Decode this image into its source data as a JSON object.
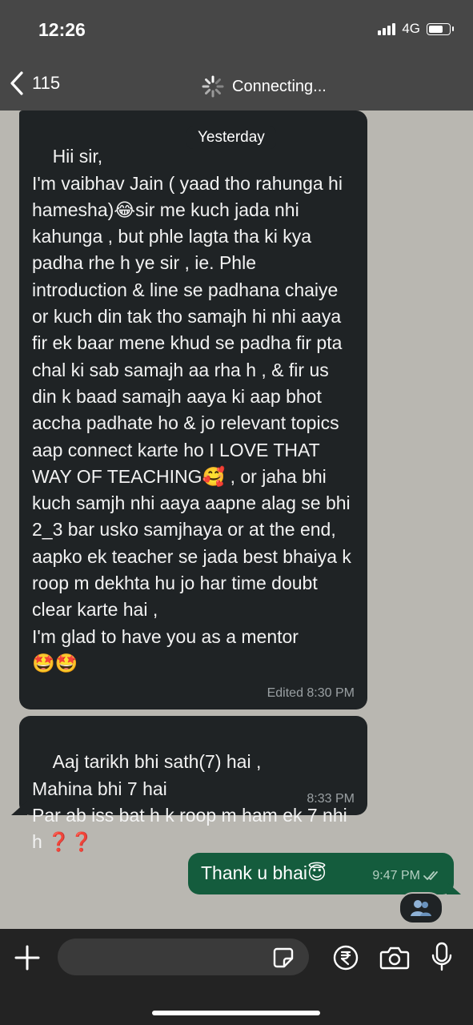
{
  "status_bar": {
    "time": "12:26",
    "network": "4G"
  },
  "header": {
    "back_count": "115",
    "status": "Connecting..."
  },
  "date_chip": "Yesterday",
  "messages": [
    {
      "direction": "incoming",
      "text": "Hii sir,\nI'm vaibhav Jain ( yaad tho rahunga hi hamesha)😂sir me kuch jada nhi kahunga , but phle lagta tha ki kya padha rhe h ye sir , ie. Phle introduction & line se padhana chaiye or kuch din tak tho samajh hi nhi aaya fir ek baar mene khud se padha fir pta chal ki sab samajh aa rha h , & fir us din k baad samajh aaya ki aap bhot accha padhate ho & jo relevant topics aap connect karte ho I LOVE THAT WAY OF TEACHING🥰 , or jaha bhi kuch samjh nhi aaya aapne alag se bhi 2_3 bar usko samjhaya or at the end, aapko ek teacher se jada best bhaiya k roop m dekhta hu jo har time doubt clear karte hai ,\nI'm glad to have you as a mentor\n🤩🤩",
      "meta": "Edited 8:30 PM"
    },
    {
      "direction": "incoming",
      "text": "Aaj tarikh bhi sath(7) hai ,\nMahina bhi 7 hai\nPar ab iss bat h k roop m ham ek 7 nhi h ❓❓",
      "meta": "8:33 PM"
    },
    {
      "direction": "outgoing",
      "text": "Thank u bhai😇",
      "meta": "9:47 PM"
    }
  ],
  "input": {
    "placeholder": ""
  },
  "colors": {
    "incoming": "#1f2325",
    "outgoing": "#145c3d",
    "chrome": "#474747",
    "wallpaper": "#b9b7b1"
  }
}
